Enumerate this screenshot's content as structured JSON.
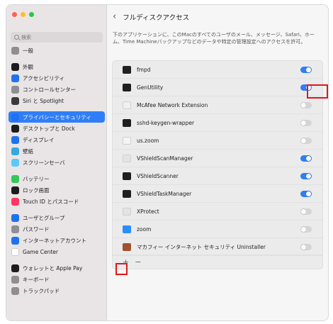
{
  "header": {
    "back_icon": "chevron-left-icon",
    "title": "フルディスクアクセス"
  },
  "description": "下のアプリケーションに、このMacのすべてのユーザのメール、メッセージ、Safari、ホーム、Time Machineバックアップなどのデータや特定の管理設定へのアクセスを許可。",
  "search": {
    "placeholder": "検索"
  },
  "sidebar": {
    "items": [
      {
        "label": "一般",
        "icon": "gear-icon",
        "color": "#8e8e93"
      },
      {
        "label": "外観",
        "icon": "appearance-icon",
        "color": "#1c1c1e"
      },
      {
        "label": "アクセシビリティ",
        "icon": "accessibility-icon",
        "color": "#1e72f0"
      },
      {
        "label": "コントロールセンター",
        "icon": "control-center-icon",
        "color": "#8e8e93"
      },
      {
        "label": "Siri と Spotlight",
        "icon": "siri-icon",
        "color": "#3a3a3c"
      },
      {
        "label": "プライバシーとセキュリティ",
        "icon": "hand-icon",
        "color": "#1e72f0",
        "active": true
      },
      {
        "label": "デスクトップと Dock",
        "icon": "dock-icon",
        "color": "#1c1c1e"
      },
      {
        "label": "ディスプレイ",
        "icon": "display-icon",
        "color": "#1e72f0"
      },
      {
        "label": "壁紙",
        "icon": "wallpaper-icon",
        "color": "#35a8e0"
      },
      {
        "label": "スクリーンセーバ",
        "icon": "screensaver-icon",
        "color": "#5ac8fa"
      },
      {
        "label": "バッテリー",
        "icon": "battery-icon",
        "color": "#34c759"
      },
      {
        "label": "ロック画面",
        "icon": "lock-icon",
        "color": "#1c1c1e"
      },
      {
        "label": "Touch ID とパスコード",
        "icon": "fingerprint-icon",
        "color": "#ff375f"
      },
      {
        "label": "ユーザとグループ",
        "icon": "users-icon",
        "color": "#1e72f0"
      },
      {
        "label": "パスワード",
        "icon": "key-icon",
        "color": "#8e8e93"
      },
      {
        "label": "インターネットアカウント",
        "icon": "at-icon",
        "color": "#1e72f0"
      },
      {
        "label": "Game Center",
        "icon": "game-center-icon",
        "color": "#ffffff"
      },
      {
        "label": "ウォレットと Apple Pay",
        "icon": "wallet-icon",
        "color": "#1c1c1e"
      },
      {
        "label": "キーボード",
        "icon": "keyboard-icon",
        "color": "#8e8e93"
      },
      {
        "label": "トラックパッド",
        "icon": "trackpad-icon",
        "color": "#8e8e93"
      }
    ]
  },
  "apps": [
    {
      "name": "fmpd",
      "icon": "terminal-icon",
      "color": "#1f1f1f",
      "enabled": true,
      "highlighted": true
    },
    {
      "name": "GenUtility",
      "icon": "terminal-icon",
      "color": "#1f1f1f",
      "enabled": true
    },
    {
      "name": "McAfee Network Extension",
      "icon": "shield-icon",
      "color": "#f0f0f0",
      "enabled": false
    },
    {
      "name": "sshd-keygen-wrapper",
      "icon": "terminal-icon",
      "color": "#1f1f1f",
      "enabled": false
    },
    {
      "name": "us.zoom",
      "icon": "document-icon",
      "color": "#f4f4f4",
      "enabled": false
    },
    {
      "name": "VShieldScanManager",
      "icon": "generic-app-icon",
      "color": "#e3e3e3",
      "enabled": true
    },
    {
      "name": "VShieldScanner",
      "icon": "terminal-icon",
      "color": "#1f1f1f",
      "enabled": true
    },
    {
      "name": "VShieldTaskManager",
      "icon": "terminal-icon",
      "color": "#1f1f1f",
      "enabled": true
    },
    {
      "name": "XProtect",
      "icon": "generic-app-icon",
      "color": "#e3e3e3",
      "enabled": false
    },
    {
      "name": "zoom",
      "icon": "zoom-icon",
      "color": "#2d8cff",
      "enabled": false
    },
    {
      "name": "マカフィー インターネット セキュリティ Uninstaller",
      "icon": "box-icon",
      "color": "#a0522d",
      "enabled": false
    }
  ],
  "controls": {
    "add": "+",
    "remove": "−"
  },
  "colors": {
    "accent": "#2f7ef7",
    "highlight": "#e01717"
  }
}
